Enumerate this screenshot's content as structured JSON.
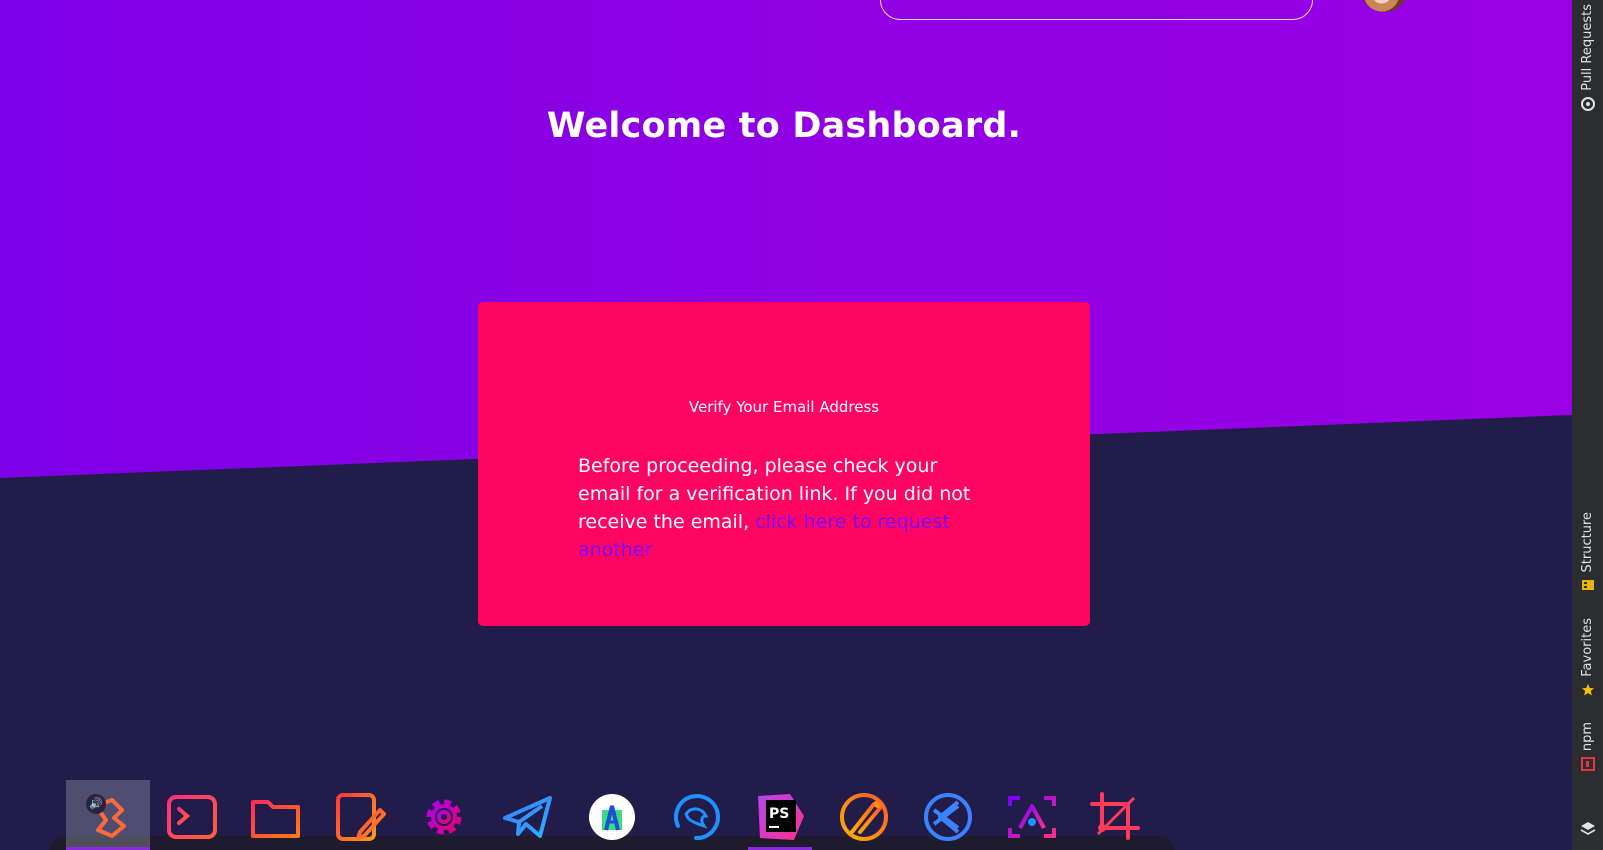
{
  "header": {
    "search_placeholder": "",
    "avatar_alt": "user avatar"
  },
  "page": {
    "title": "Welcome to Dashboard."
  },
  "verify_card": {
    "title": "Verify Your Email Address",
    "body_text": "Before proceeding, please check your email for a verification link. If you did not receive the email,",
    "link_text": "click here to request another"
  },
  "colors": {
    "hero_gradient_start": "#7d00e6",
    "hero_gradient_end": "#9a00e5",
    "lower_background": "#211c4a",
    "card_background": "#ff0561",
    "link": "#7a00ff"
  },
  "dock": {
    "items": [
      {
        "name": "web-browser-icon",
        "active": true
      },
      {
        "name": "terminal-icon"
      },
      {
        "name": "folder-icon"
      },
      {
        "name": "text-editor-icon"
      },
      {
        "name": "settings-gear-icon"
      },
      {
        "name": "telegram-icon"
      },
      {
        "name": "android-studio-icon"
      },
      {
        "name": "mysql-workbench-icon"
      },
      {
        "name": "phpstorm-icon",
        "open": true,
        "text": "PS"
      },
      {
        "name": "postman-icon"
      },
      {
        "name": "vscode-icon"
      },
      {
        "name": "app-icon"
      },
      {
        "name": "crop-tool-icon"
      }
    ],
    "sound_badge": "🔊"
  },
  "toolstrip": {
    "pull_requests": "Pull Requests",
    "structure": "Structure",
    "favorites": "Favorites",
    "npm": "npm"
  }
}
